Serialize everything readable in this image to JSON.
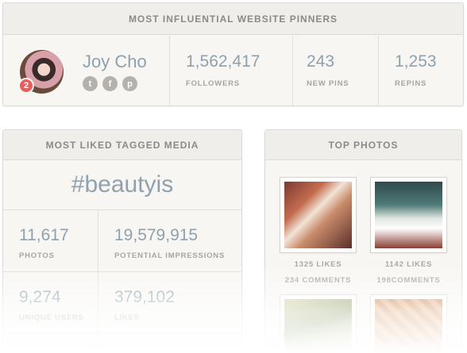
{
  "influential": {
    "title": "MOST INFLUENTIAL WEBSITE PINNERS",
    "profile": {
      "name": "Joy Cho",
      "badge": "2",
      "socials": [
        "twitter-icon",
        "facebook-icon",
        "pinterest-icon"
      ]
    },
    "stats": [
      {
        "value": "1,562,417",
        "label": "FOLLOWERS"
      },
      {
        "value": "243",
        "label": "NEW PINS"
      },
      {
        "value": "1,253",
        "label": "REPINS"
      }
    ]
  },
  "media": {
    "title": "MOST LIKED TAGGED MEDIA",
    "hashtag": "#beautyis",
    "stats": [
      {
        "value": "11,617",
        "label": "PHOTOS"
      },
      {
        "value": "19,579,915",
        "label": "POTENTIAL IMPRESSIONS"
      },
      {
        "value": "9,274",
        "label": "UNIQUE USERS"
      },
      {
        "value": "379,102",
        "label": "LIKES"
      }
    ]
  },
  "photos": {
    "title": "TOP PHOTOS",
    "items": [
      {
        "likes": "1325 LIKES",
        "comments": "234 COMMENTS"
      },
      {
        "likes": "1142 LIKES",
        "comments": "198COMMENTS"
      }
    ]
  },
  "colors": {
    "accent": "#8fa1ad",
    "badge": "#ee5b5b",
    "label": "#a8a5a0",
    "card": "#f7f6f3"
  }
}
